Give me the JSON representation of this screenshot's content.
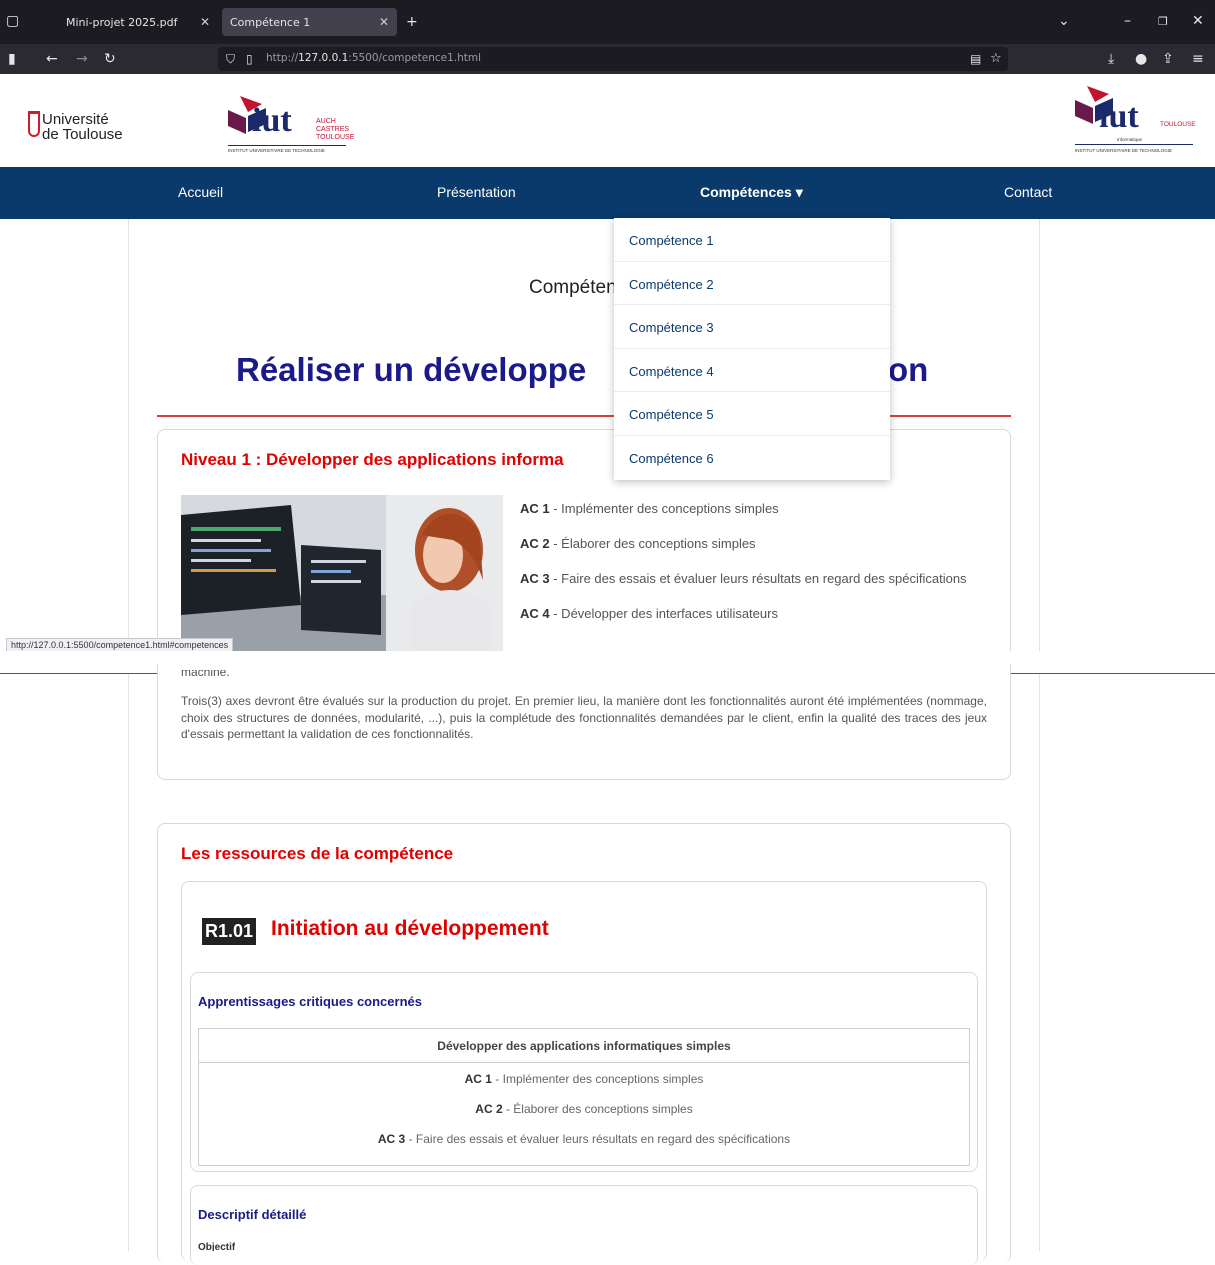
{
  "browser": {
    "tabs": [
      {
        "title": "Mini-projet 2025.pdf"
      },
      {
        "title": "Compétence 1"
      }
    ],
    "url_prefix": "http://",
    "url_host": "127.0.0.1",
    "url_rest": ":5500/competence1.html",
    "status_url": "http://127.0.0.1:5500/competence1.html#competences"
  },
  "header": {
    "ut_line1": "Université",
    "ut_line2": "de Toulouse",
    "iut_text": "iut",
    "iut_cities": [
      "AUCH",
      "CASTRES",
      "TOULOUSE"
    ],
    "iut_sub": "INSTITUT UNIVERSITAIRE DE TECHNOLOGIE",
    "iut2_city": "TOULOUSE",
    "iut2_tag": "Informatique",
    "colors": {
      "navy": "#0a3a6b",
      "red": "#e10000",
      "title_blue": "#1a1a8a"
    }
  },
  "nav": {
    "items": [
      "Accueil",
      "Présentation",
      "Compétences ▾",
      "Contact"
    ]
  },
  "dropdown": {
    "items": [
      "Compétence 1",
      "Compétence 2",
      "Compétence 3",
      "Compétence 4",
      "Compétence 5",
      "Compétence 6"
    ]
  },
  "main": {
    "subtitle_visible": "Compéten",
    "title_left": "Réaliser un développe",
    "title_right": "on",
    "level_title": "Niveau 1 : Développer des applications informa",
    "acs": [
      {
        "code": "AC 1",
        "text": " - Implémenter des conceptions simples"
      },
      {
        "code": "AC 2",
        "text": " - Élaborer des conceptions simples"
      },
      {
        "code": "AC 3",
        "text": " - Faire des essais et évaluer leurs résultats en regard des spécifications"
      },
      {
        "code": "AC 4",
        "text": " - Développer des interfaces utilisateurs"
      }
    ],
    "partial_word": "machine.",
    "paragraph": "Trois(3) axes devront être évalués sur la production du projet. En premier lieu, la manière dont les fonctionnalités auront été implémentées (nommage, choix des structures de données, modularité, ...), puis la complétude des fonctionnalités demandées par le client, enfin la qualité des traces des jeux d'essais permettant la validation de ces fonctionnalités."
  },
  "resources": {
    "title": "Les ressources de la compétence",
    "code": "R1.01",
    "name": "Initiation au développement",
    "ac_section_title": "Apprentissages critiques concernés",
    "table_header": "Développer des applications informatiques simples",
    "table_rows": [
      {
        "code": "AC 1",
        "text": " - Implémenter des conceptions simples"
      },
      {
        "code": "AC 2",
        "text": " - Élaborer des conceptions simples"
      },
      {
        "code": "AC 3",
        "text": " - Faire des essais et évaluer leurs résultats en regard des spécifications"
      }
    ],
    "desc_title": "Descriptif détaillé",
    "objectif": "Objectif"
  }
}
